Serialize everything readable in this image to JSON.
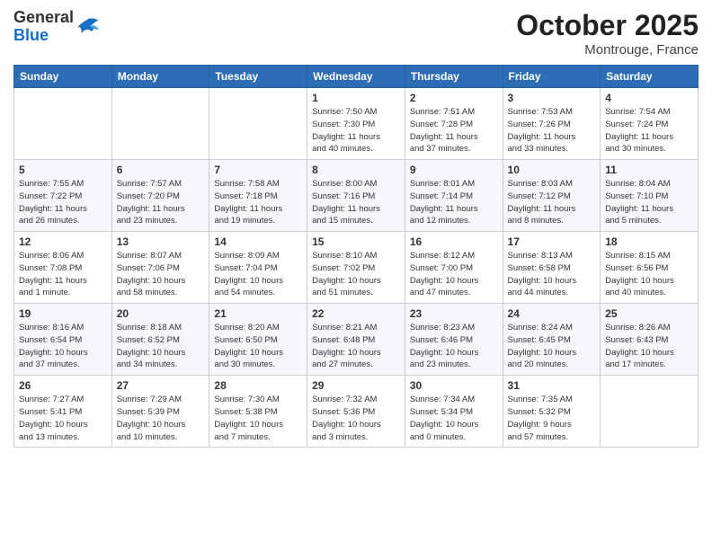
{
  "header": {
    "logo_general": "General",
    "logo_blue": "Blue",
    "month_title": "October 2025",
    "location": "Montrouge, France"
  },
  "weekdays": [
    "Sunday",
    "Monday",
    "Tuesday",
    "Wednesday",
    "Thursday",
    "Friday",
    "Saturday"
  ],
  "weeks": [
    [
      {
        "day": "",
        "info": ""
      },
      {
        "day": "",
        "info": ""
      },
      {
        "day": "",
        "info": ""
      },
      {
        "day": "1",
        "info": "Sunrise: 7:50 AM\nSunset: 7:30 PM\nDaylight: 11 hours\nand 40 minutes."
      },
      {
        "day": "2",
        "info": "Sunrise: 7:51 AM\nSunset: 7:28 PM\nDaylight: 11 hours\nand 37 minutes."
      },
      {
        "day": "3",
        "info": "Sunrise: 7:53 AM\nSunset: 7:26 PM\nDaylight: 11 hours\nand 33 minutes."
      },
      {
        "day": "4",
        "info": "Sunrise: 7:54 AM\nSunset: 7:24 PM\nDaylight: 11 hours\nand 30 minutes."
      }
    ],
    [
      {
        "day": "5",
        "info": "Sunrise: 7:55 AM\nSunset: 7:22 PM\nDaylight: 11 hours\nand 26 minutes."
      },
      {
        "day": "6",
        "info": "Sunrise: 7:57 AM\nSunset: 7:20 PM\nDaylight: 11 hours\nand 23 minutes."
      },
      {
        "day": "7",
        "info": "Sunrise: 7:58 AM\nSunset: 7:18 PM\nDaylight: 11 hours\nand 19 minutes."
      },
      {
        "day": "8",
        "info": "Sunrise: 8:00 AM\nSunset: 7:16 PM\nDaylight: 11 hours\nand 15 minutes."
      },
      {
        "day": "9",
        "info": "Sunrise: 8:01 AM\nSunset: 7:14 PM\nDaylight: 11 hours\nand 12 minutes."
      },
      {
        "day": "10",
        "info": "Sunrise: 8:03 AM\nSunset: 7:12 PM\nDaylight: 11 hours\nand 8 minutes."
      },
      {
        "day": "11",
        "info": "Sunrise: 8:04 AM\nSunset: 7:10 PM\nDaylight: 11 hours\nand 5 minutes."
      }
    ],
    [
      {
        "day": "12",
        "info": "Sunrise: 8:06 AM\nSunset: 7:08 PM\nDaylight: 11 hours\nand 1 minute."
      },
      {
        "day": "13",
        "info": "Sunrise: 8:07 AM\nSunset: 7:06 PM\nDaylight: 10 hours\nand 58 minutes."
      },
      {
        "day": "14",
        "info": "Sunrise: 8:09 AM\nSunset: 7:04 PM\nDaylight: 10 hours\nand 54 minutes."
      },
      {
        "day": "15",
        "info": "Sunrise: 8:10 AM\nSunset: 7:02 PM\nDaylight: 10 hours\nand 51 minutes."
      },
      {
        "day": "16",
        "info": "Sunrise: 8:12 AM\nSunset: 7:00 PM\nDaylight: 10 hours\nand 47 minutes."
      },
      {
        "day": "17",
        "info": "Sunrise: 8:13 AM\nSunset: 6:58 PM\nDaylight: 10 hours\nand 44 minutes."
      },
      {
        "day": "18",
        "info": "Sunrise: 8:15 AM\nSunset: 6:56 PM\nDaylight: 10 hours\nand 40 minutes."
      }
    ],
    [
      {
        "day": "19",
        "info": "Sunrise: 8:16 AM\nSunset: 6:54 PM\nDaylight: 10 hours\nand 37 minutes."
      },
      {
        "day": "20",
        "info": "Sunrise: 8:18 AM\nSunset: 6:52 PM\nDaylight: 10 hours\nand 34 minutes."
      },
      {
        "day": "21",
        "info": "Sunrise: 8:20 AM\nSunset: 6:50 PM\nDaylight: 10 hours\nand 30 minutes."
      },
      {
        "day": "22",
        "info": "Sunrise: 8:21 AM\nSunset: 6:48 PM\nDaylight: 10 hours\nand 27 minutes."
      },
      {
        "day": "23",
        "info": "Sunrise: 8:23 AM\nSunset: 6:46 PM\nDaylight: 10 hours\nand 23 minutes."
      },
      {
        "day": "24",
        "info": "Sunrise: 8:24 AM\nSunset: 6:45 PM\nDaylight: 10 hours\nand 20 minutes."
      },
      {
        "day": "25",
        "info": "Sunrise: 8:26 AM\nSunset: 6:43 PM\nDaylight: 10 hours\nand 17 minutes."
      }
    ],
    [
      {
        "day": "26",
        "info": "Sunrise: 7:27 AM\nSunset: 5:41 PM\nDaylight: 10 hours\nand 13 minutes."
      },
      {
        "day": "27",
        "info": "Sunrise: 7:29 AM\nSunset: 5:39 PM\nDaylight: 10 hours\nand 10 minutes."
      },
      {
        "day": "28",
        "info": "Sunrise: 7:30 AM\nSunset: 5:38 PM\nDaylight: 10 hours\nand 7 minutes."
      },
      {
        "day": "29",
        "info": "Sunrise: 7:32 AM\nSunset: 5:36 PM\nDaylight: 10 hours\nand 3 minutes."
      },
      {
        "day": "30",
        "info": "Sunrise: 7:34 AM\nSunset: 5:34 PM\nDaylight: 10 hours\nand 0 minutes."
      },
      {
        "day": "31",
        "info": "Sunrise: 7:35 AM\nSunset: 5:32 PM\nDaylight: 9 hours\nand 57 minutes."
      },
      {
        "day": "",
        "info": ""
      }
    ]
  ]
}
